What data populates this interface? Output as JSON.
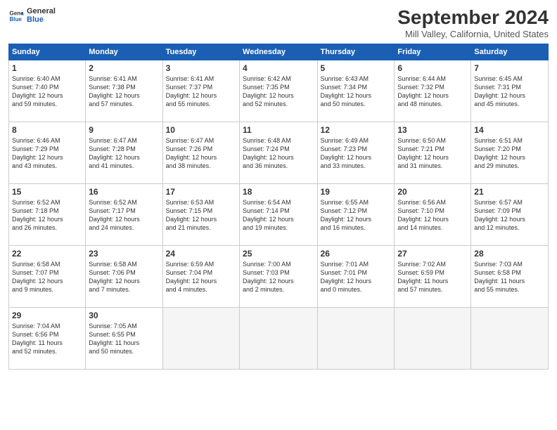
{
  "header": {
    "logo_line1": "General",
    "logo_line2": "Blue",
    "month_title": "September 2024",
    "location": "Mill Valley, California, United States"
  },
  "calendar": {
    "headers": [
      "Sunday",
      "Monday",
      "Tuesday",
      "Wednesday",
      "Thursday",
      "Friday",
      "Saturday"
    ],
    "weeks": [
      [
        {
          "day": null
        },
        {
          "day": 2,
          "info": "Sunrise: 6:41 AM\nSunset: 7:38 PM\nDaylight: 12 hours\nand 57 minutes."
        },
        {
          "day": 3,
          "info": "Sunrise: 6:41 AM\nSunset: 7:37 PM\nDaylight: 12 hours\nand 55 minutes."
        },
        {
          "day": 4,
          "info": "Sunrise: 6:42 AM\nSunset: 7:35 PM\nDaylight: 12 hours\nand 52 minutes."
        },
        {
          "day": 5,
          "info": "Sunrise: 6:43 AM\nSunset: 7:34 PM\nDaylight: 12 hours\nand 50 minutes."
        },
        {
          "day": 6,
          "info": "Sunrise: 6:44 AM\nSunset: 7:32 PM\nDaylight: 12 hours\nand 48 minutes."
        },
        {
          "day": 7,
          "info": "Sunrise: 6:45 AM\nSunset: 7:31 PM\nDaylight: 12 hours\nand 45 minutes."
        }
      ],
      [
        {
          "day": 1,
          "info": "Sunrise: 6:40 AM\nSunset: 7:40 PM\nDaylight: 12 hours\nand 59 minutes."
        },
        {
          "day": 9,
          "info": "Sunrise: 6:47 AM\nSunset: 7:28 PM\nDaylight: 12 hours\nand 41 minutes."
        },
        {
          "day": 10,
          "info": "Sunrise: 6:47 AM\nSunset: 7:26 PM\nDaylight: 12 hours\nand 38 minutes."
        },
        {
          "day": 11,
          "info": "Sunrise: 6:48 AM\nSunset: 7:24 PM\nDaylight: 12 hours\nand 36 minutes."
        },
        {
          "day": 12,
          "info": "Sunrise: 6:49 AM\nSunset: 7:23 PM\nDaylight: 12 hours\nand 33 minutes."
        },
        {
          "day": 13,
          "info": "Sunrise: 6:50 AM\nSunset: 7:21 PM\nDaylight: 12 hours\nand 31 minutes."
        },
        {
          "day": 14,
          "info": "Sunrise: 6:51 AM\nSunset: 7:20 PM\nDaylight: 12 hours\nand 29 minutes."
        }
      ],
      [
        {
          "day": 8,
          "info": "Sunrise: 6:46 AM\nSunset: 7:29 PM\nDaylight: 12 hours\nand 43 minutes."
        },
        {
          "day": 16,
          "info": "Sunrise: 6:52 AM\nSunset: 7:17 PM\nDaylight: 12 hours\nand 24 minutes."
        },
        {
          "day": 17,
          "info": "Sunrise: 6:53 AM\nSunset: 7:15 PM\nDaylight: 12 hours\nand 21 minutes."
        },
        {
          "day": 18,
          "info": "Sunrise: 6:54 AM\nSunset: 7:14 PM\nDaylight: 12 hours\nand 19 minutes."
        },
        {
          "day": 19,
          "info": "Sunrise: 6:55 AM\nSunset: 7:12 PM\nDaylight: 12 hours\nand 16 minutes."
        },
        {
          "day": 20,
          "info": "Sunrise: 6:56 AM\nSunset: 7:10 PM\nDaylight: 12 hours\nand 14 minutes."
        },
        {
          "day": 21,
          "info": "Sunrise: 6:57 AM\nSunset: 7:09 PM\nDaylight: 12 hours\nand 12 minutes."
        }
      ],
      [
        {
          "day": 15,
          "info": "Sunrise: 6:52 AM\nSunset: 7:18 PM\nDaylight: 12 hours\nand 26 minutes."
        },
        {
          "day": 23,
          "info": "Sunrise: 6:58 AM\nSunset: 7:06 PM\nDaylight: 12 hours\nand 7 minutes."
        },
        {
          "day": 24,
          "info": "Sunrise: 6:59 AM\nSunset: 7:04 PM\nDaylight: 12 hours\nand 4 minutes."
        },
        {
          "day": 25,
          "info": "Sunrise: 7:00 AM\nSunset: 7:03 PM\nDaylight: 12 hours\nand 2 minutes."
        },
        {
          "day": 26,
          "info": "Sunrise: 7:01 AM\nSunset: 7:01 PM\nDaylight: 12 hours\nand 0 minutes."
        },
        {
          "day": 27,
          "info": "Sunrise: 7:02 AM\nSunset: 6:59 PM\nDaylight: 11 hours\nand 57 minutes."
        },
        {
          "day": 28,
          "info": "Sunrise: 7:03 AM\nSunset: 6:58 PM\nDaylight: 11 hours\nand 55 minutes."
        }
      ],
      [
        {
          "day": 22,
          "info": "Sunrise: 6:58 AM\nSunset: 7:07 PM\nDaylight: 12 hours\nand 9 minutes."
        },
        {
          "day": 30,
          "info": "Sunrise: 7:05 AM\nSunset: 6:55 PM\nDaylight: 11 hours\nand 50 minutes."
        },
        {
          "day": null
        },
        {
          "day": null
        },
        {
          "day": null
        },
        {
          "day": null
        },
        {
          "day": null
        }
      ],
      [
        {
          "day": 29,
          "info": "Sunrise: 7:04 AM\nSunset: 6:56 PM\nDaylight: 11 hours\nand 52 minutes."
        },
        {
          "day": null
        },
        {
          "day": null
        },
        {
          "day": null
        },
        {
          "day": null
        },
        {
          "day": null
        },
        {
          "day": null
        }
      ]
    ]
  }
}
